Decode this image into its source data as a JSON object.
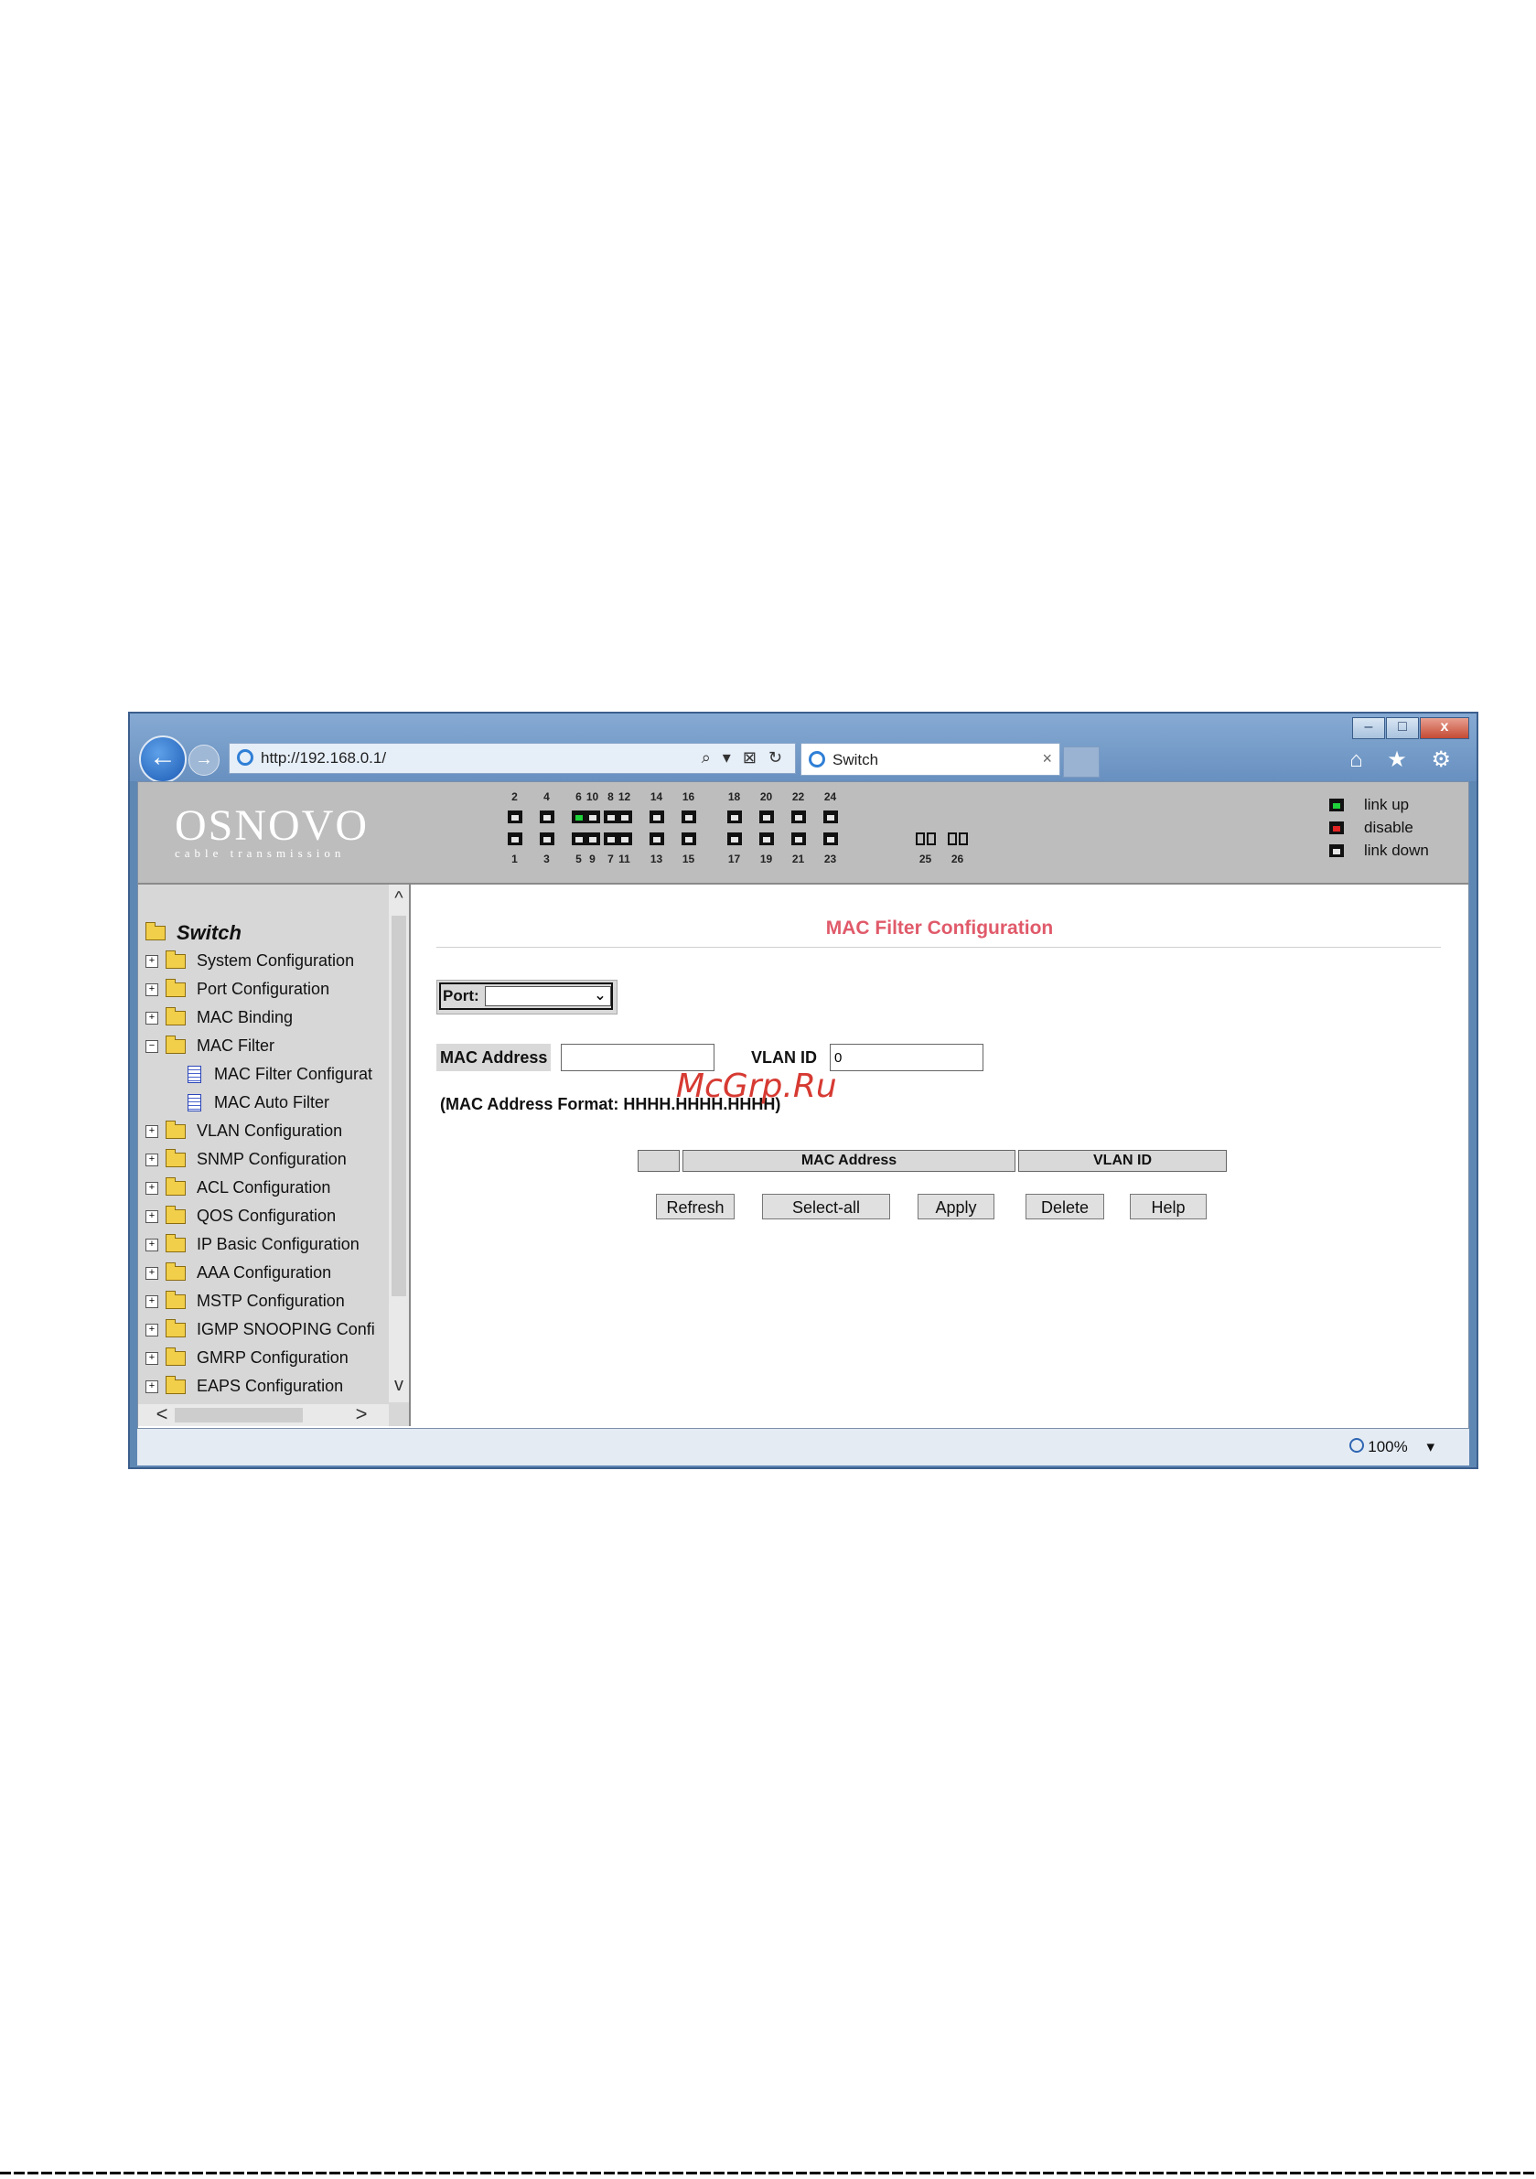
{
  "browser": {
    "url": "http://192.168.0.1/",
    "tab_title": "Switch",
    "tab_close": "×",
    "address_tools": "⌕ ▾ ⊠ ↻",
    "nav_icons": "⌂ ★ ⚙",
    "window_controls": {
      "minimize": "–",
      "maximize": "□",
      "close": "x"
    },
    "back": "←",
    "forward": "→",
    "zoom": "100%",
    "zoom_caret": "▾"
  },
  "banner": {
    "logo_main": "OSNOVO",
    "logo_sub": "cable transmission",
    "ports_top": [
      "2",
      "4",
      "6",
      "8",
      "10",
      "12",
      "14",
      "16",
      "18",
      "20",
      "22",
      "24"
    ],
    "ports_bottom": [
      "1",
      "3",
      "5",
      "7",
      "9",
      "11",
      "13",
      "15",
      "17",
      "19",
      "21",
      "23"
    ],
    "sfp_ports": [
      "25",
      "26"
    ],
    "linked_ports": [
      "6"
    ],
    "legend": {
      "up": "link up",
      "disable": "disable",
      "down": "link down"
    },
    "colors": {
      "link_up": "#1fd13a",
      "disable": "#e02424",
      "link_down": "#e6e6e6"
    }
  },
  "sidebar": {
    "root": "Switch",
    "items": [
      "System Configuration",
      "Port Configuration",
      "MAC Binding",
      "MAC Filter",
      "MAC Filter Configurat",
      "MAC Auto Filter",
      "VLAN Configuration",
      "SNMP Configuration",
      "ACL Configuration",
      "QOS Configuration",
      "IP Basic Configuration",
      "AAA Configuration",
      "MSTP Configuration",
      "IGMP SNOOPING Confi",
      "GMRP Configuration",
      "EAPS Configuration"
    ],
    "expand_plus": "+",
    "expand_minus": "−",
    "scroll_up": "^",
    "scroll_down": "v",
    "scroll_left": "<",
    "scroll_right": ">"
  },
  "main": {
    "title": "MAC Filter Configuration",
    "port_label": "Port:",
    "port_value": "",
    "port_chevron": "⌄",
    "mac_label": "MAC Address",
    "mac_value": "",
    "vlan_label": "VLAN ID",
    "vlan_value": "0",
    "format_note": "(MAC Address Format: HHHH.HHHH.HHHH)",
    "watermark": "McGrp.Ru",
    "table_headers": [
      "",
      "MAC Address",
      "VLAN ID"
    ],
    "buttons": {
      "refresh": "Refresh",
      "select_all": "Select-all",
      "apply": "Apply",
      "delete": "Delete",
      "help": "Help"
    },
    "title_color": "#e05a6a"
  }
}
